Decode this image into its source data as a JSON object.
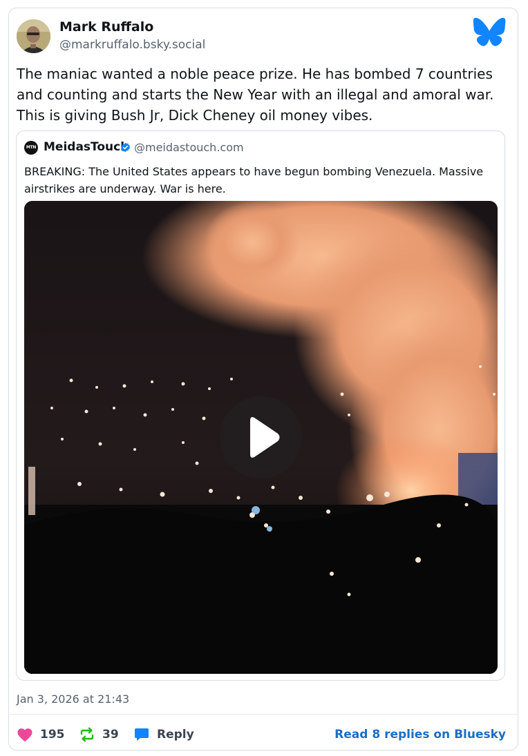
{
  "post": {
    "author_name": "Mark Ruffalo",
    "author_handle": "@markruffalo.bsky.social",
    "text": "The maniac wanted a noble peace prize. He has bombed 7 countries and counting and starts the New Year with an illegal and amoral war. This is giving Bush Jr, Dick Cheney oil money vibes.",
    "timestamp": "Jan 3, 2026 at 21:43"
  },
  "quote": {
    "avatar_text": "MTN",
    "author_name": "MeidasTouch",
    "author_handle": "@meidastouch.com",
    "verified": true,
    "text": "BREAKING: The United States appears to have begun bombing Venezuela. Massive airstrikes are underway. War is here."
  },
  "actions": {
    "likes": "195",
    "reposts": "39",
    "reply_label": "Reply",
    "read_replies_label": "Read 8 replies on Bluesky"
  },
  "icons": {
    "brand": "bluesky-butterfly-icon",
    "like": "heart-icon",
    "repost": "repost-icon",
    "reply": "reply-bubble-icon",
    "play": "play-icon",
    "verified": "verified-badge-icon"
  },
  "colors": {
    "brand_blue": "#1185fe",
    "like_pink": "#ec4899",
    "repost_green": "#20bc07",
    "reply_blue": "#1185fe",
    "link_blue": "#1a6dc7"
  }
}
